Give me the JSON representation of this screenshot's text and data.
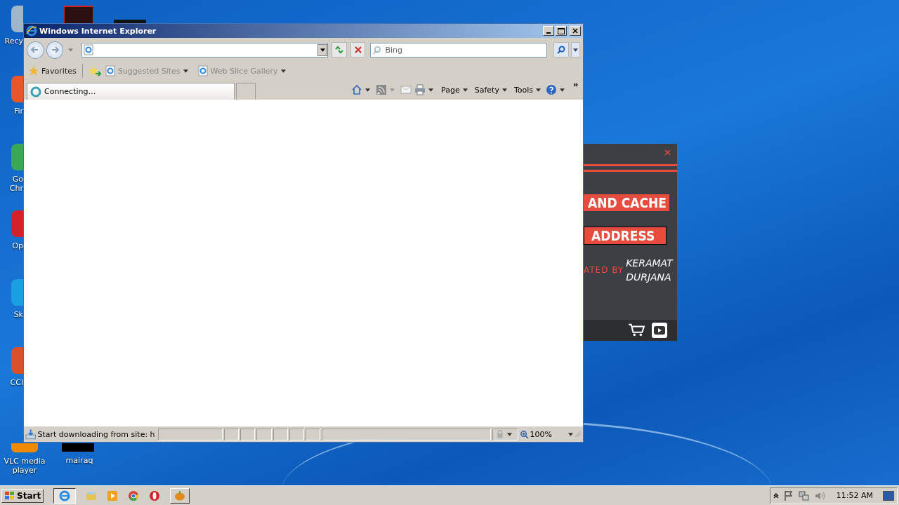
{
  "desktop_icons": [
    {
      "lines": [
        "Recy"
      ],
      "kind": "covered"
    },
    {
      "lines": [
        "Fir"
      ],
      "kind": "covered"
    },
    {
      "lines": [
        "Go",
        "Chr"
      ],
      "kind": "covered"
    },
    {
      "lines": [
        "Op"
      ],
      "kind": "covered"
    },
    {
      "lines": [
        "Sk"
      ],
      "kind": "covered"
    },
    {
      "lines": [
        "CCl"
      ],
      "kind": "covered"
    },
    {
      "lines": [
        "VLC media",
        "player"
      ],
      "kind": "full"
    },
    {
      "lines": [
        "mairaq"
      ],
      "kind": "bar"
    }
  ],
  "browser": {
    "title": "Windows Internet Explorer",
    "search_placeholder": "Bing",
    "favorites": "Favorites",
    "links": [
      "Suggested Sites",
      "Web Slice Gallery"
    ],
    "tab": "Connecting…",
    "commands": [
      "Page",
      "Safety",
      "Tools"
    ],
    "status": "Start downloading from site: h",
    "zoom": "100%"
  },
  "popup": {
    "banners": [
      {
        "text": "AND CACHE",
        "kind": "plain"
      },
      {
        "text": "ADDRESS",
        "kind": "outlined"
      }
    ],
    "credit_prefix": "ATED BY",
    "credit_name": [
      "KERAMAT",
      "DURJANA"
    ]
  },
  "taskbar": {
    "start": "Start",
    "clock": "11:52 AM"
  }
}
